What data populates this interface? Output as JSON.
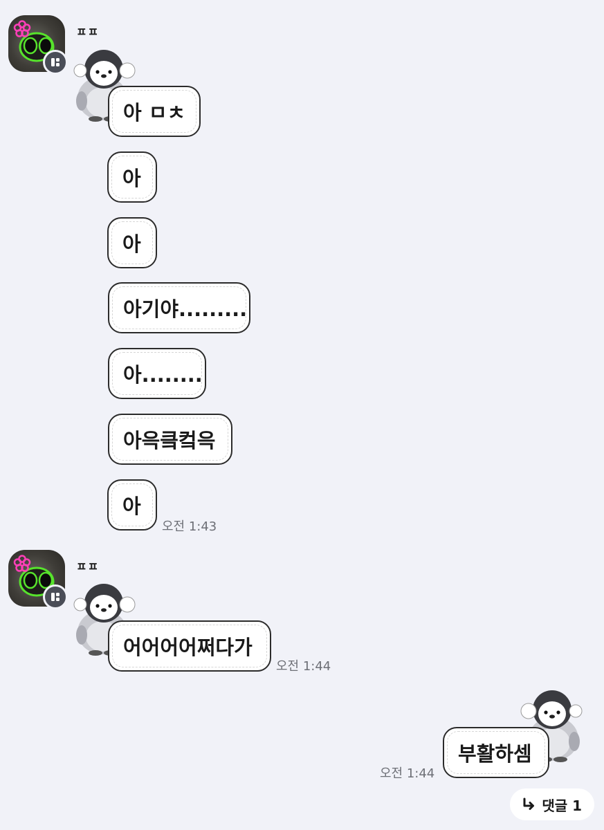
{
  "messages_in": [
    {
      "text": "아 ㅁㅊ"
    },
    {
      "text": "아"
    },
    {
      "text": "아"
    },
    {
      "text": "아기야........."
    },
    {
      "text": "아........"
    },
    {
      "text": "아윽킄컼윽"
    },
    {
      "text": "아"
    }
  ],
  "group1": {
    "sender": "ㅍㅍ",
    "time": "오전 1:43"
  },
  "group2": {
    "sender": "ㅍㅍ",
    "message": "어어어어쩌다가",
    "time": "오전 1:44"
  },
  "outgoing": {
    "message": "부활하셈",
    "time": "오전 1:44"
  },
  "reply_button": {
    "label": "댓글 1"
  },
  "icons": {
    "avatar_badge": "app-badge-icon",
    "reply_arrow": "reply-arrow-icon",
    "sticker": "penguin-sticker"
  },
  "colors": {
    "background": "#f1f2f8",
    "bubble": "#ffffff",
    "bubble_border": "#2b2b2b"
  }
}
